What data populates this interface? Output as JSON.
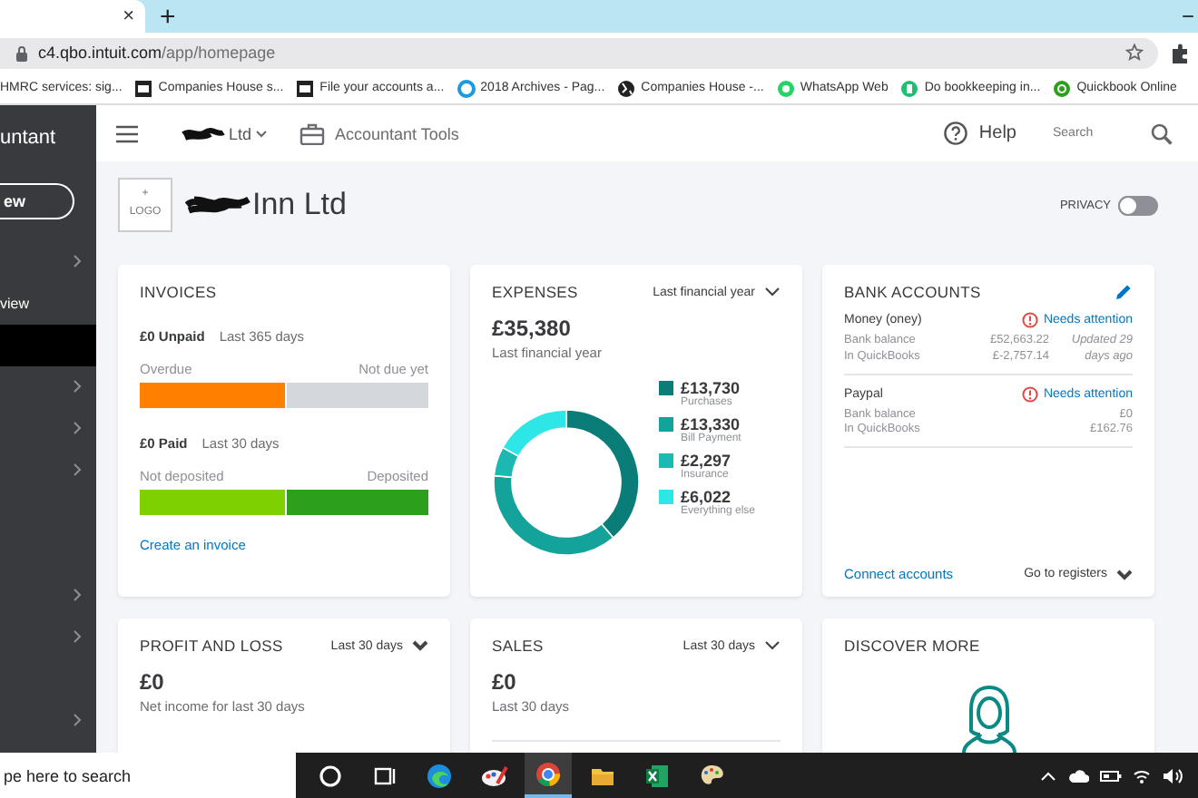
{
  "browser": {
    "tab_close": "×",
    "new_tab": "+",
    "minimize": "−",
    "url_host": "c4.qbo.intuit.com",
    "url_path": "/app/homepage"
  },
  "bookmarks": [
    {
      "label": "HMRC services: sig...",
      "kind": "none"
    },
    {
      "label": "Companies House s...",
      "kind": "box"
    },
    {
      "label": "File your accounts a...",
      "kind": "box"
    },
    {
      "label": "2018 Archives - Pag...",
      "kind": "ring"
    },
    {
      "label": "Companies House -...",
      "kind": "globe"
    },
    {
      "label": "WhatsApp Web",
      "kind": "chat"
    },
    {
      "label": "Do bookkeeping in...",
      "kind": "doc"
    },
    {
      "label": "Quickbook Online",
      "kind": "qb"
    }
  ],
  "sidebar": {
    "title": "untant",
    "new_button": "ew",
    "items": [
      {
        "selected": false,
        "expandable": true
      },
      {
        "label": "view",
        "selected": false,
        "expandable": false
      },
      {
        "selected": true,
        "expandable": false
      },
      {
        "selected": false,
        "expandable": true
      },
      {
        "selected": false,
        "expandable": true
      },
      {
        "selected": false,
        "expandable": true
      },
      {
        "selected": false,
        "expandable": true
      },
      {
        "selected": false,
        "expandable": true
      },
      {
        "selected": false,
        "expandable": true
      }
    ]
  },
  "topbar": {
    "company": "Ltd",
    "tools": "Accountant Tools",
    "help": "Help",
    "search_placeholder": "Search"
  },
  "company_header": {
    "logo_plus": "+",
    "logo_label": "LOGO",
    "name": "Inn Ltd",
    "privacy": {
      "label": "PRIVACY",
      "on": false
    }
  },
  "invoices": {
    "title": "INVOICES",
    "unpaid": "£0 Unpaid",
    "unpaid_period": "Last 365 days",
    "unpaid_left": "Overdue",
    "unpaid_right": "Not due yet",
    "unpaid_bar": {
      "level": 0.5
    },
    "paid": "£0 Paid",
    "paid_period": "Last 30 days",
    "paid_left": "Not deposited",
    "paid_right": "Deposited",
    "paid_bar": {
      "level": 0.5
    },
    "link": "Create an invoice"
  },
  "expenses": {
    "title": "EXPENSES",
    "period": "Last financial year",
    "total": "£35,380",
    "caption": "Last financial year",
    "chart_data": {
      "type": "donut",
      "categories": [
        "Purchases",
        "Bill Payment",
        "Insurance",
        "Everything else"
      ],
      "values": [
        38.81,
        37.68,
        6.49,
        17.02
      ]
    },
    "legend": [
      {
        "amount": "£13,730",
        "color": "#0b7d78"
      },
      {
        "amount": "£13,330",
        "color": "#14a39b"
      },
      {
        "amount": "£2,297",
        "color": "#1db8b1"
      },
      {
        "amount": "£6,022",
        "color": "#2fe6e6"
      }
    ]
  },
  "bank_accounts": {
    "title": "BANK ACCOUNTS",
    "accounts": [
      {
        "name": "Money (oney)",
        "status": "Needs attention",
        "rows": [
          {
            "label": "Bank balance",
            "value": "£52,663.22"
          },
          {
            "label": "In QuickBooks",
            "value": "£-2,757.14"
          }
        ],
        "note": "Updated 29 days ago"
      },
      {
        "name": "Paypal",
        "status": "Needs attention",
        "rows": [
          {
            "label": "Bank balance",
            "value": "£0"
          },
          {
            "label": "In QuickBooks",
            "value": "£162.76"
          }
        ]
      }
    ],
    "connect": "Connect accounts",
    "registers": "Go to registers"
  },
  "profit_and_loss": {
    "title": "PROFIT AND LOSS",
    "period": "Last 30 days",
    "amount": "£0",
    "caption": "Net income for last 30 days"
  },
  "sales": {
    "title": "SALES",
    "period": "Last 30 days",
    "amount": "£0",
    "caption": "Last 30 days"
  },
  "discover": {
    "title": "DISCOVER MORE"
  },
  "taskbar": {
    "search_placeholder": "pe here to search",
    "apps": [
      {
        "kind": "cortana",
        "selected": false
      },
      {
        "kind": "taskview",
        "selected": false
      },
      {
        "kind": "edge",
        "selected": false
      },
      {
        "kind": "paint",
        "selected": false
      },
      {
        "kind": "chrome",
        "selected": true
      },
      {
        "kind": "folder",
        "selected": false
      },
      {
        "kind": "excel",
        "selected": false
      },
      {
        "kind": "palette",
        "selected": false
      }
    ]
  }
}
